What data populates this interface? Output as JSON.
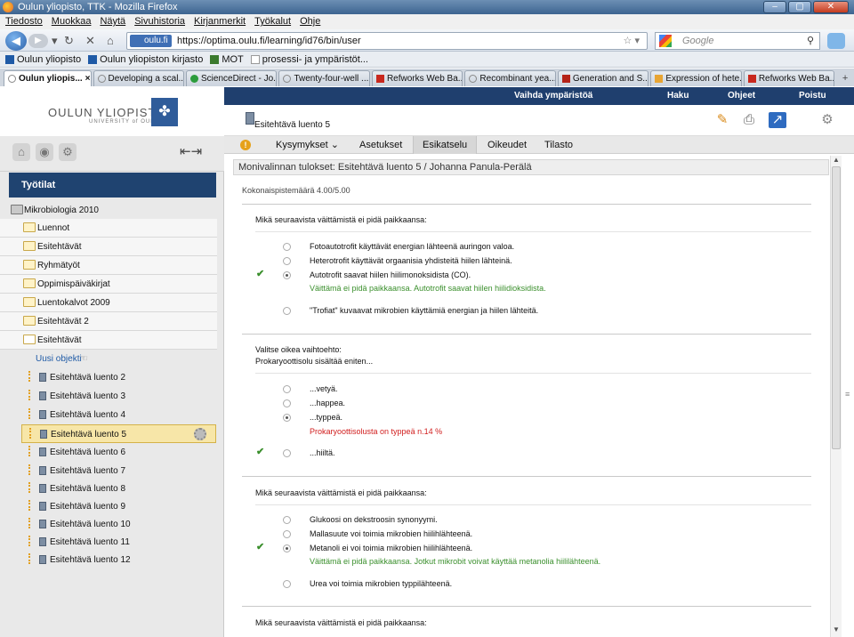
{
  "window": {
    "title": "Oulun yliopisto, TTK - Mozilla Firefox",
    "buttons": [
      "–",
      "▢",
      "✕"
    ]
  },
  "menu": [
    "Tiedosto",
    "Muokkaa",
    "Näytä",
    "Sivuhistoria",
    "Kirjanmerkit",
    "Työkalut",
    "Ohje"
  ],
  "nav": {
    "site_badge": "oulu.fi",
    "url": "https://optima.oulu.fi/learning/id76/bin/user",
    "search_placeholder": "Google"
  },
  "bookmarks": [
    "Oulun yliopisto",
    "Oulun yliopiston kirjasto",
    "MOT",
    "prosessi- ja ympäristöt..."
  ],
  "tabs": [
    {
      "label": "Oulun yliopis...",
      "active": true
    },
    {
      "label": "Developing a scal...",
      "active": false
    },
    {
      "label": "ScienceDirect - Jo...",
      "active": false
    },
    {
      "label": "Twenty-four-well ...",
      "active": false
    },
    {
      "label": "Refworks Web Ba...",
      "active": false
    },
    {
      "label": "Recombinant yea...",
      "active": false
    },
    {
      "label": "Generation and S...",
      "active": false
    },
    {
      "label": "Expression of hete...",
      "active": false
    },
    {
      "label": "Refworks Web Ba...",
      "active": false
    }
  ],
  "tabs_close": "×",
  "tabs_more": "+",
  "logo": {
    "line1": "OULUN YLIOPISTO",
    "line2": "UNIVERSITY of OULU"
  },
  "topbar": {
    "vaihda": "Vaihda ympäristöä",
    "haku": "Haku",
    "ohjeet": "Ohjeet",
    "poistu": "Poistu"
  },
  "header": {
    "item_name": "Esitehtävä luento 5"
  },
  "app_tabs": [
    "Kysymykset ⌄",
    "Asetukset",
    "Esikatselu",
    "Oikeudet",
    "Tilasto"
  ],
  "left": {
    "workspaces_label": "Työtilat",
    "course": "Mikrobiologia 2010",
    "folders": [
      "Luennot",
      "Esitehtävät",
      "Ryhmätyöt",
      "Oppimispäiväkirjat",
      "Luentokalvot 2009",
      "Esitehtävät 2",
      "Esitehtävät"
    ],
    "new_object": "Uusi objekti",
    "items": [
      "Esitehtävä luento 2",
      "Esitehtävä luento 3",
      "Esitehtävä luento 4",
      "Esitehtävä luento 5",
      "Esitehtävä luento 6",
      "Esitehtävä luento 7",
      "Esitehtävä luento 8",
      "Esitehtävä luento 9",
      "Esitehtävä luento 10",
      "Esitehtävä luento 11",
      "Esitehtävä luento 12"
    ]
  },
  "content": {
    "breadcrumb": "Monivalinnan tulokset: Esitehtävä luento 5 / Johanna Panula-Perälä",
    "score": "Kokonaispistemäärä 4.00/5.00",
    "q1": {
      "title": "Mikä seuraavista väittämistä ei pidä paikkaansa:",
      "options": [
        "Fotoautotrofit käyttävät energian lähteenä auringon valoa.",
        "Heterotrofit käyttävät orgaanisia yhdisteitä hiilen lähteinä.",
        "Autotrofit saavat hiilen hiilimonoksidista (CO).",
        "\"Trofiat\" kuvaavat mikrobien käyttämiä energian ja hiilen lähteitä."
      ],
      "feedback": "Väittämä ei pidä paikkaansa. Autotrofit saavat hiilen hiilidioksidista."
    },
    "q2": {
      "title1": "Valitse oikea vaihtoehto:",
      "title2": "Prokaryoottisolu sisältää eniten...",
      "options": [
        "...vetyä.",
        "...happea.",
        "...typpeä.",
        "...hiiltä."
      ],
      "feedback": "Prokaryoottisolusta on typpeä n.14 %"
    },
    "q3": {
      "title": "Mikä seuraavista väittämistä ei pidä paikkaansa:",
      "options": [
        "Glukoosi on dekstroosin synonyymi.",
        "Mallasuute voi toimia mikrobien hiilihlähteenä.",
        "Metanoli ei voi toimia mikrobien hiilihlähteenä.",
        "Urea voi toimia mikrobien typpilähteenä."
      ],
      "feedback": "Väittämä ei pidä paikkaansa. Jotkut mikrobit voivat käyttää metanolia hiililähteenä."
    },
    "q4": {
      "title": "Mikä seuraavista väittämistä ei pidä paikkaansa:"
    }
  },
  "colors": {
    "accent": "#1f3f6e",
    "ok": "#3a8f2c",
    "bad": "#d11e1e",
    "selected": "#f7e6a8"
  }
}
